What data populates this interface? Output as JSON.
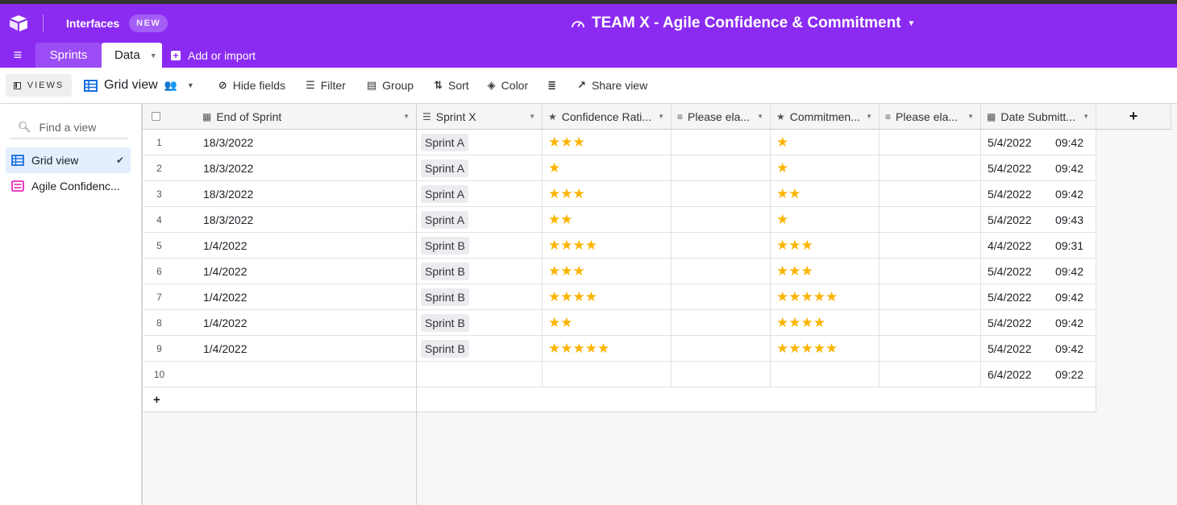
{
  "header": {
    "interfaces_label": "Interfaces",
    "new_badge": "NEW",
    "base_title": "TEAM X - Agile Confidence & Commitment"
  },
  "tabs": {
    "sprints": "Sprints",
    "data": "Data",
    "add_or_import": "Add or import"
  },
  "toolbar": {
    "views": "VIEWS",
    "grid_view": "Grid view",
    "hide_fields": "Hide fields",
    "filter": "Filter",
    "group": "Group",
    "sort": "Sort",
    "color": "Color",
    "share_view": "Share view"
  },
  "sidebar": {
    "find_placeholder": "Find a view",
    "items": [
      {
        "label": "Grid view",
        "active": true
      },
      {
        "label": "Agile Confidenc..."
      }
    ]
  },
  "columns": {
    "end_of_sprint": "End of Sprint",
    "sprint_x": "Sprint X",
    "confidence": "Confidence Rati...",
    "please_ela_1": "Please ela...",
    "commitment": "Commitmen...",
    "please_ela_2": "Please ela...",
    "date_submitted": "Date Submitt..."
  },
  "rows": [
    {
      "num": "1",
      "end": "18/3/2022",
      "sprint": "Sprint A",
      "conf": 3,
      "commit": 1,
      "date": "5/4/2022",
      "time": "09:42"
    },
    {
      "num": "2",
      "end": "18/3/2022",
      "sprint": "Sprint A",
      "conf": 1,
      "commit": 1,
      "date": "5/4/2022",
      "time": "09:42"
    },
    {
      "num": "3",
      "end": "18/3/2022",
      "sprint": "Sprint A",
      "conf": 3,
      "commit": 2,
      "date": "5/4/2022",
      "time": "09:42"
    },
    {
      "num": "4",
      "end": "18/3/2022",
      "sprint": "Sprint A",
      "conf": 2,
      "commit": 1,
      "date": "5/4/2022",
      "time": "09:43"
    },
    {
      "num": "5",
      "end": "1/4/2022",
      "sprint": "Sprint B",
      "conf": 4,
      "commit": 3,
      "date": "4/4/2022",
      "time": "09:31"
    },
    {
      "num": "6",
      "end": "1/4/2022",
      "sprint": "Sprint B",
      "conf": 3,
      "commit": 3,
      "date": "5/4/2022",
      "time": "09:42"
    },
    {
      "num": "7",
      "end": "1/4/2022",
      "sprint": "Sprint B",
      "conf": 4,
      "commit": 5,
      "date": "5/4/2022",
      "time": "09:42"
    },
    {
      "num": "8",
      "end": "1/4/2022",
      "sprint": "Sprint B",
      "conf": 2,
      "commit": 4,
      "date": "5/4/2022",
      "time": "09:42"
    },
    {
      "num": "9",
      "end": "1/4/2022",
      "sprint": "Sprint B",
      "conf": 5,
      "commit": 5,
      "date": "5/4/2022",
      "time": "09:42"
    },
    {
      "num": "10",
      "end": "",
      "sprint": "",
      "conf": 0,
      "commit": 0,
      "date": "6/4/2022",
      "time": "09:22"
    }
  ],
  "colors": {
    "brand": "#8b2bf2",
    "star": "#fcb400",
    "active_view": "#e3effd"
  }
}
